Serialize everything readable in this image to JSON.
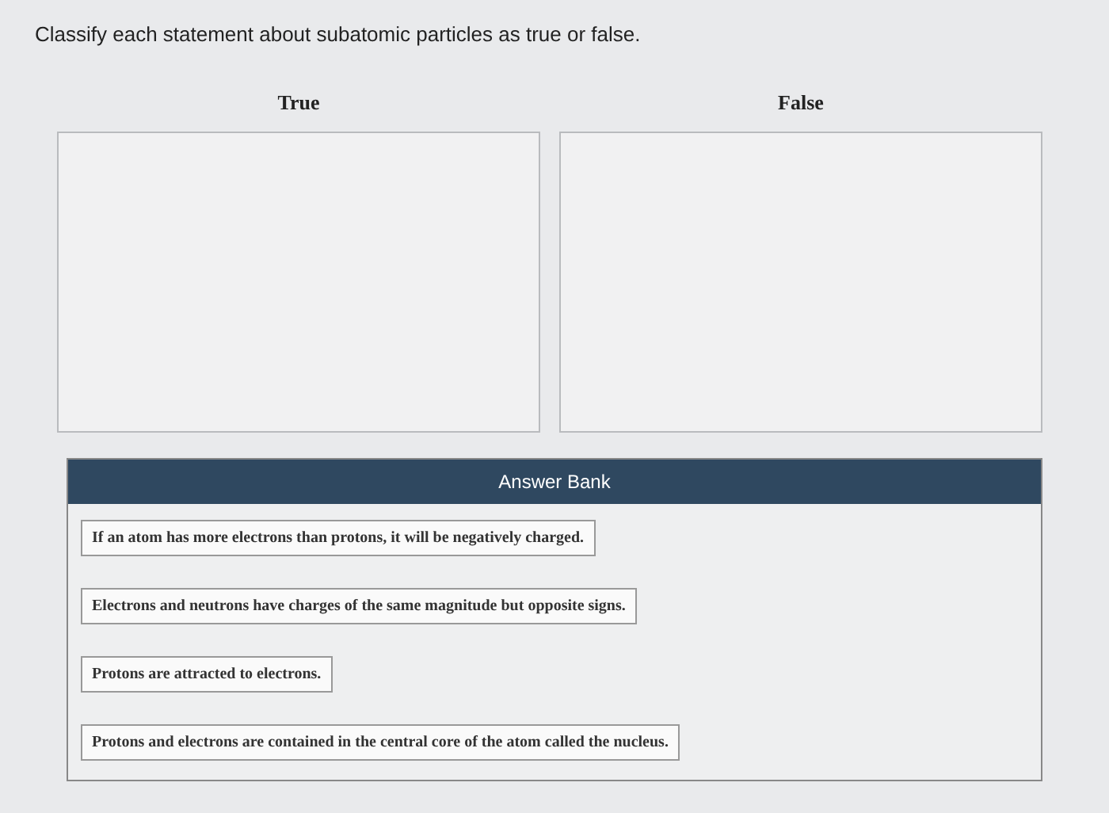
{
  "prompt": "Classify each statement about subatomic particles as true or false.",
  "bins": [
    {
      "label": "True"
    },
    {
      "label": "False"
    }
  ],
  "answer_bank": {
    "title": "Answer Bank",
    "items": [
      "If an atom has more electrons than protons, it will be negatively charged.",
      "Electrons and neutrons have charges of the same magnitude but opposite signs.",
      "Protons are attracted to electrons.",
      "Protons and electrons are contained in the central core of the atom called the nucleus."
    ]
  }
}
